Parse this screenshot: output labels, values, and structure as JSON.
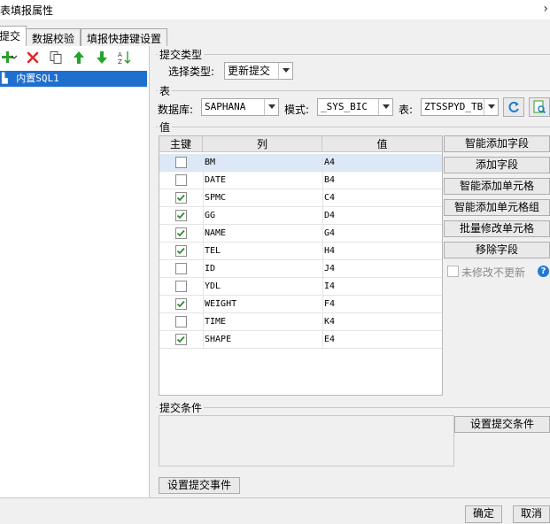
{
  "window": {
    "title": "表填报属性"
  },
  "tabs": [
    {
      "label": "提交"
    },
    {
      "label": "数据校验"
    },
    {
      "label": "填报快捷键设置"
    }
  ],
  "left": {
    "toolbar": [
      "add-icon",
      "delete-icon",
      "copy-icon",
      "move-up-icon",
      "move-down-icon",
      "sort-icon"
    ],
    "tree_item": "内置SQL1"
  },
  "submit_type": {
    "legend": "提交类型",
    "label": "选择类型:",
    "value": "更新提交"
  },
  "table": {
    "legend": "表",
    "db_label": "数据库:",
    "db_value": "SAPHANA",
    "schema_label": "模式:",
    "schema_value": "_SYS_BIC",
    "table_label": "表:",
    "table_value": "ZTSSPYD_TB"
  },
  "values": {
    "legend": "值",
    "headers": {
      "key": "主键",
      "column": "列",
      "value": "值"
    },
    "rows": [
      {
        "checked": false,
        "column": "BM",
        "value": "A4",
        "selected": true
      },
      {
        "checked": false,
        "column": "DATE",
        "value": "B4"
      },
      {
        "checked": true,
        "column": "SPMC",
        "value": "C4"
      },
      {
        "checked": true,
        "column": "GG",
        "value": "D4"
      },
      {
        "checked": true,
        "column": "NAME",
        "value": "G4"
      },
      {
        "checked": true,
        "column": "TEL",
        "value": "H4"
      },
      {
        "checked": false,
        "column": "ID",
        "value": "J4"
      },
      {
        "checked": false,
        "column": "YDL",
        "value": "I4"
      },
      {
        "checked": true,
        "column": "WEIGHT",
        "value": "F4"
      },
      {
        "checked": false,
        "column": "TIME",
        "value": "K4"
      },
      {
        "checked": true,
        "column": "SHAPE",
        "value": "E4"
      }
    ],
    "buttons": {
      "smart_add_field": "智能添加字段",
      "add_field": "添加字段",
      "smart_add_cell": "智能添加单元格",
      "smart_add_cell_group": "智能添加单元格组",
      "batch_modify_cell": "批量修改单元格",
      "remove_field": "移除字段"
    },
    "no_update_label": "未修改不更新"
  },
  "condition": {
    "legend": "提交条件",
    "button": "设置提交条件"
  },
  "event_button": "设置提交事件",
  "footer": {
    "ok": "确定",
    "cancel": "取消"
  },
  "colors": {
    "selection": "#1f6fce",
    "check": "#2e8b2e",
    "help": "#1e7ad6"
  }
}
